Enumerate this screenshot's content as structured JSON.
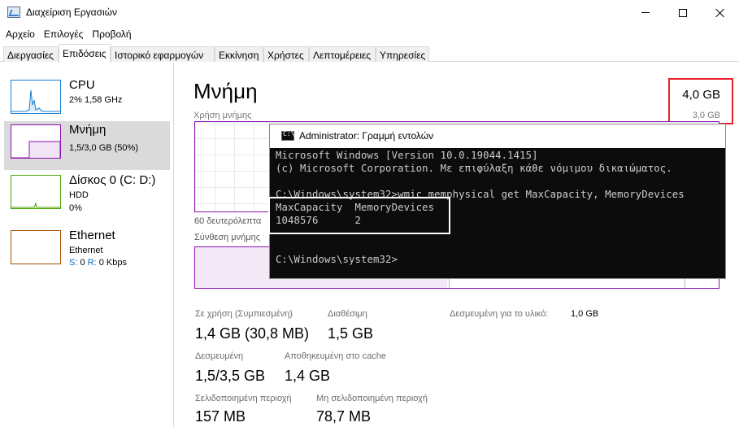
{
  "window": {
    "title": "Διαχείριση Εργασιών"
  },
  "menu": [
    "Αρχείο",
    "Επιλογές",
    "Προβολή"
  ],
  "tabs": [
    {
      "label": "Διεργασίες",
      "active": false
    },
    {
      "label": "Επιδόσεις",
      "active": true
    },
    {
      "label": "Ιστορικό εφαρμογών",
      "active": false
    },
    {
      "label": "Εκκίνηση",
      "active": false
    },
    {
      "label": "Χρήστες",
      "active": false
    },
    {
      "label": "Λεπτομέρειες",
      "active": false
    },
    {
      "label": "Υπηρεσίες",
      "active": false
    }
  ],
  "sidebar": {
    "items": [
      {
        "name": "CPU",
        "line1": "2% 1,58 GHz",
        "line2": ""
      },
      {
        "name": "Μνήμη",
        "line1": "1,5/3,0 GB (50%)",
        "line2": ""
      },
      {
        "name": "Δίσκος 0 (C: D:)",
        "line1": "HDD",
        "line2": "0%"
      },
      {
        "name": "Ethernet",
        "line1": "Ethernet",
        "line2_s": "S:",
        "line2_s_val": "0",
        "line2_r": "R:",
        "line2_r_val": "0 Kbps"
      }
    ]
  },
  "main": {
    "title": "Μνήμη",
    "usage_label": "Χρήση μνήμης",
    "capacity_total": "4,0 GB",
    "capacity_usable": "3,0 GB",
    "seconds_label": "60 δευτερόλεπτα",
    "composition_label": "Σύνθεση μνήμης",
    "stats": {
      "in_use_label": "Σε χρήση (Συμπιεσμένη)",
      "in_use_value": "1,4 GB (30,8 MB)",
      "available_label": "Διαθέσιμη",
      "available_value": "1,5 GB",
      "reserved_hw_label": "Δεσμευμένη για το υλικό:",
      "reserved_hw_value": "1,0 GB",
      "committed_label": "Δεσμευμένη",
      "committed_value": "1,5/3,5 GB",
      "cached_label": "Αποθηκευμένη στο cache",
      "cached_value": "1,4 GB",
      "paged_label": "Σελιδοποιημένη περιοχή",
      "paged_value": "157 MB",
      "nonpaged_label": "Μη σελιδοποιημένη περιοχή",
      "nonpaged_value": "78,7 MB"
    }
  },
  "cmd": {
    "title": "Administrator: Γραμμή εντολών",
    "icon_text": "C:\\",
    "lines": [
      "Microsoft Windows [Version 10.0.19044.1415]",
      "(c) Microsoft Corporation. Με επιφύλαξη κάθε νόμιμου δικαιώματος.",
      "",
      "C:\\Windows\\system32>wmic memphysical get MaxCapacity, MemoryDevices",
      "MaxCapacity  MemoryDevices",
      "1048576      2",
      "",
      "",
      "C:\\Windows\\system32>"
    ]
  }
}
